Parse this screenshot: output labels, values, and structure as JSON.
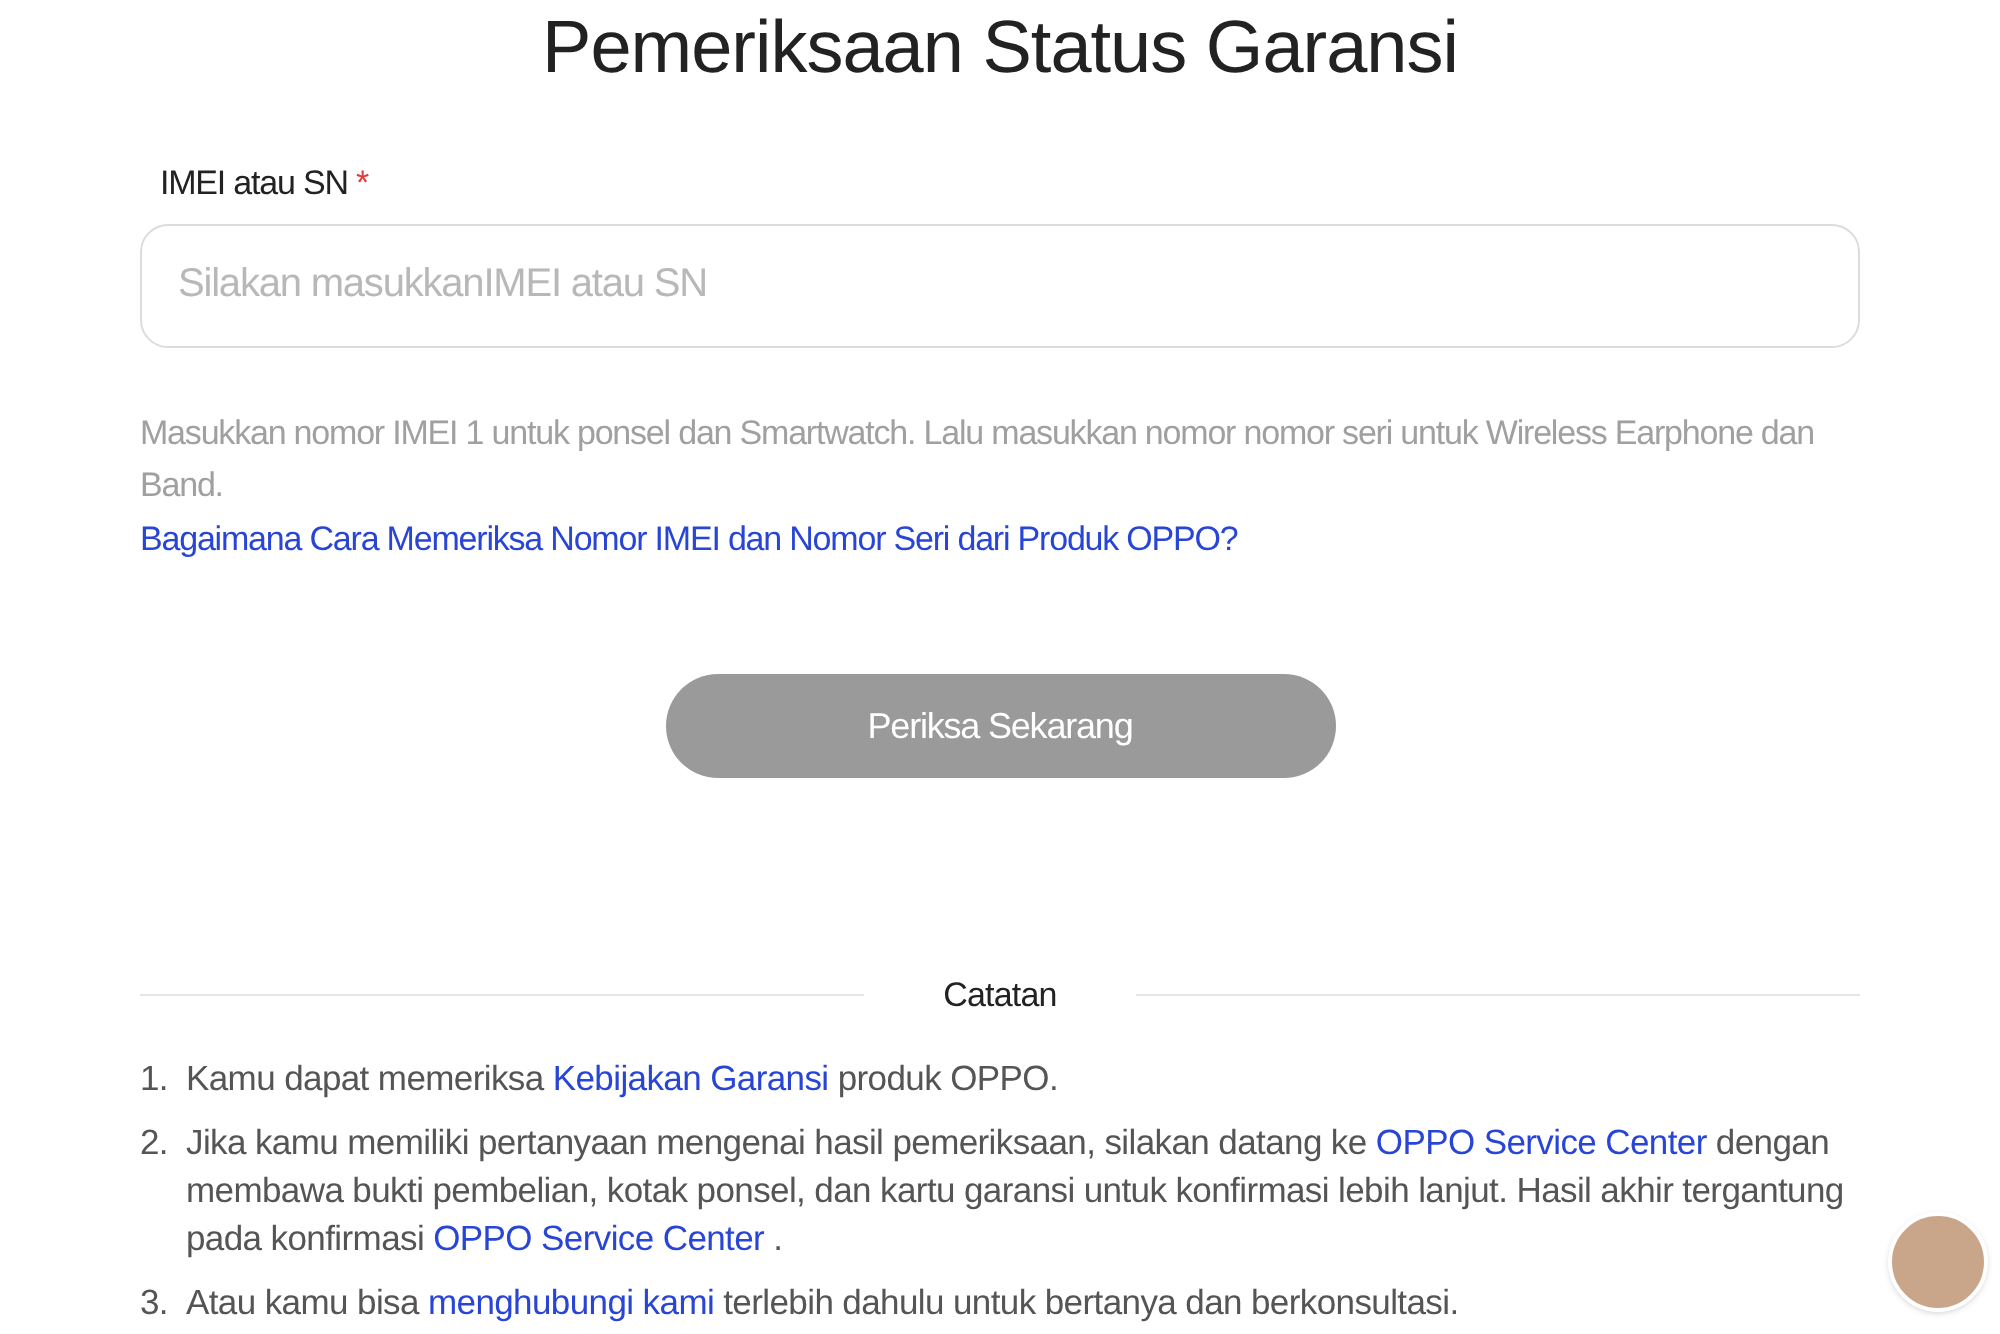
{
  "title": "Pemeriksaan Status Garansi",
  "field": {
    "label": "IMEI atau SN",
    "required_mark": "*",
    "placeholder": "Silakan masukkanIMEI atau SN"
  },
  "hint": "Masukkan nomor IMEI 1 untuk ponsel dan Smartwatch. Lalu masukkan nomor nomor seri untuk Wireless Earphone dan Band.",
  "help_link": "Bagaimana Cara Memeriksa Nomor IMEI dan Nomor Seri dari Produk OPPO?",
  "submit": {
    "label": "Periksa Sekarang",
    "disabled": true
  },
  "notes": {
    "heading": "Catatan",
    "items": [
      {
        "number": "1.",
        "segments": [
          {
            "kind": "text",
            "text": "Kamu dapat memeriksa "
          },
          {
            "kind": "link",
            "text": "Kebijakan Garansi"
          },
          {
            "kind": "text",
            "text": " produk OPPO."
          }
        ]
      },
      {
        "number": "2.",
        "segments": [
          {
            "kind": "text",
            "text": "Jika kamu memiliki pertanyaan mengenai hasil pemeriksaan, silakan datang ke "
          },
          {
            "kind": "link",
            "text": "OPPO Service Center"
          },
          {
            "kind": "text",
            "text": " dengan membawa bukti pembelian, kotak ponsel, dan kartu garansi untuk konfirmasi lebih lanjut. Hasil akhir tergantung pada konfirmasi "
          },
          {
            "kind": "link",
            "text": "OPPO Service Center"
          },
          {
            "kind": "text",
            "text": " ."
          }
        ]
      },
      {
        "number": "3.",
        "segments": [
          {
            "kind": "text",
            "text": "Atau kamu bisa "
          },
          {
            "kind": "link",
            "text": "menghubungi kami"
          },
          {
            "kind": "text",
            "text": " terlebih dahulu untuk bertanya dan berkonsultasi."
          }
        ]
      }
    ]
  }
}
